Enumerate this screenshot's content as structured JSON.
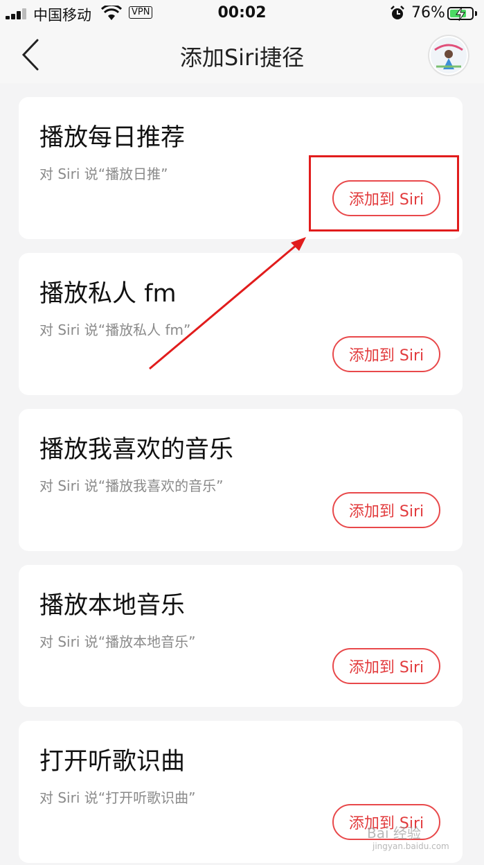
{
  "status_bar": {
    "carrier": "中国移动",
    "vpn": "VPN",
    "time": "00:02",
    "battery_percent": "76%",
    "battery_level": 0.76
  },
  "nav": {
    "title": "添加Siri捷径"
  },
  "shortcuts": [
    {
      "title": "播放每日推荐",
      "subtitle": "对 Siri 说“播放日推”",
      "button": "添加到 Siri"
    },
    {
      "title": "播放私人 fm",
      "subtitle": "对 Siri 说“播放私人 fm”",
      "button": "添加到 Siri"
    },
    {
      "title": "播放我喜欢的音乐",
      "subtitle": "对 Siri 说“播放我喜欢的音乐”",
      "button": "添加到 Siri"
    },
    {
      "title": "播放本地音乐",
      "subtitle": "对 Siri 说“播放本地音乐”",
      "button": "添加到 Siri"
    },
    {
      "title": "打开听歌识曲",
      "subtitle": "对 Siri 说“打开听歌识曲”",
      "button": "添加到 Siri"
    }
  ],
  "watermark": {
    "text": "Bai 经验",
    "sub": "jingyan.baidu.com"
  },
  "colors": {
    "accent": "#e23b3d",
    "annotation": "#e11c1c",
    "battery": "#4cd964"
  }
}
